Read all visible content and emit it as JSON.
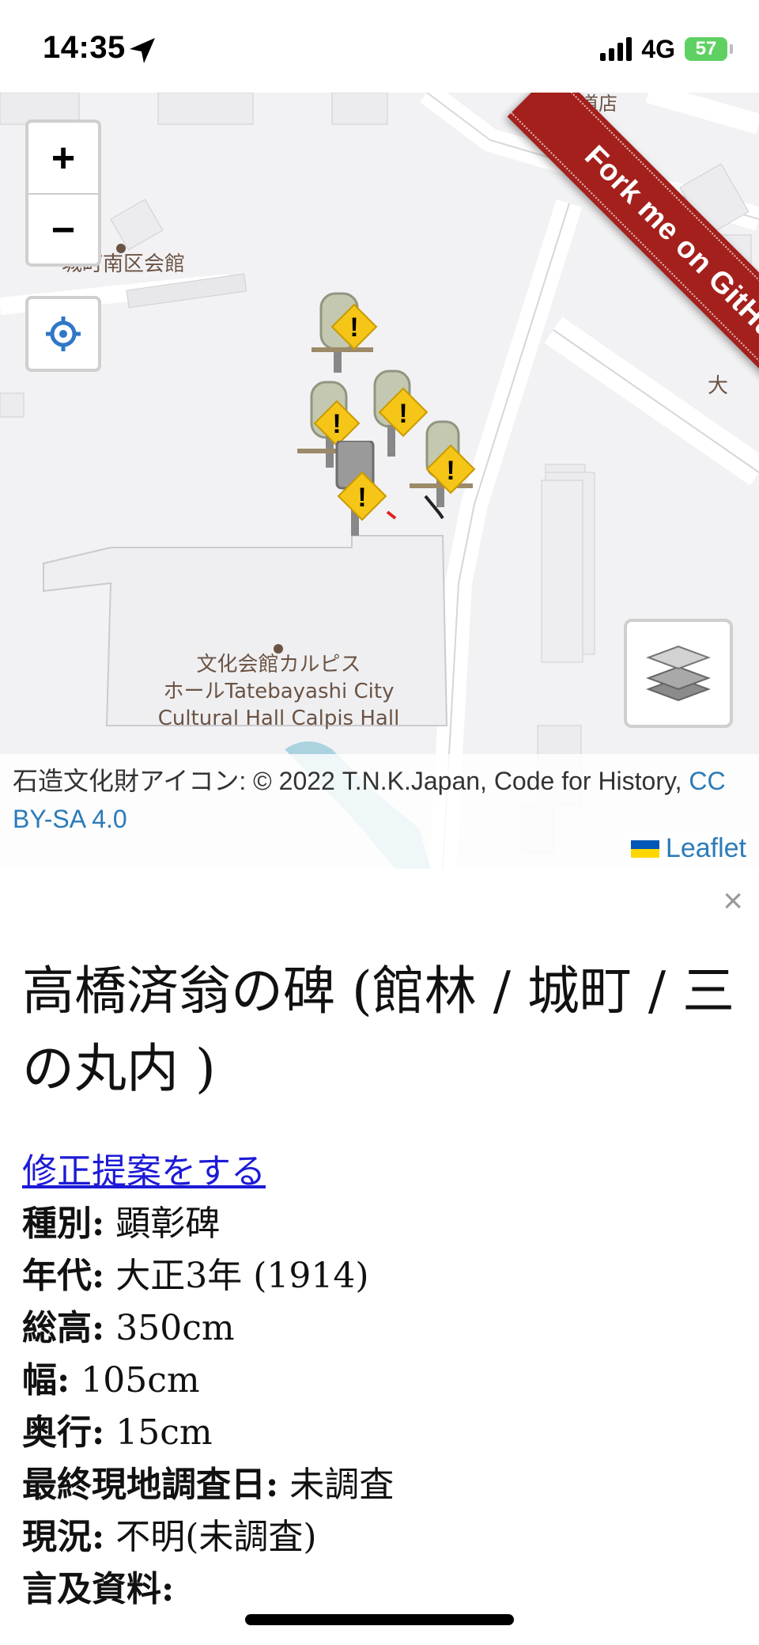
{
  "status_bar": {
    "time": "14:35",
    "nav_icon": "location-arrow-icon",
    "network": "4G",
    "battery": "57"
  },
  "map": {
    "zoom_in": "+",
    "zoom_out": "−",
    "locate_icon": "crosshair-icon",
    "layers_icon": "layers-icon",
    "labels": {
      "hall_south": "城町南区会館",
      "top_partial": "日装道店",
      "right_partial": "大",
      "cultural_hall_line1": "文化会館カルピス",
      "cultural_hall_line2": "ホールTatebayashi City",
      "cultural_hall_line3": "Cultural Hall Calpis Hall"
    },
    "ribbon": "Fork me on GitHub",
    "attribution": {
      "text": "石造文化財アイコン: © 2022 T.N.K.Japan, Code for History, ",
      "license": "CC BY-SA 4.0",
      "leaflet": "Leaflet"
    },
    "colors": {
      "warning": "#f5c518",
      "ribbon": "#a4201c",
      "link": "#2b7bb9"
    }
  },
  "popup": {
    "close": "×",
    "title": "高橋済翁の碑 (館林 / 城町 / 三の丸内 )",
    "edit_link": "修正提案をする",
    "properties": [
      {
        "label": "種別:",
        "value": " 顕彰碑"
      },
      {
        "label": "年代:",
        "value": " 大正3年 (1914)"
      },
      {
        "label": "総高:",
        "value": " 350cm"
      },
      {
        "label": "幅:",
        "value": " 105cm"
      },
      {
        "label": "奥行:",
        "value": " 15cm"
      },
      {
        "label": "最終現地調査日:",
        "value": " 未調査"
      },
      {
        "label": "現況:",
        "value": " 不明(未調査)"
      },
      {
        "label": "言及資料:",
        "value": ""
      }
    ]
  }
}
